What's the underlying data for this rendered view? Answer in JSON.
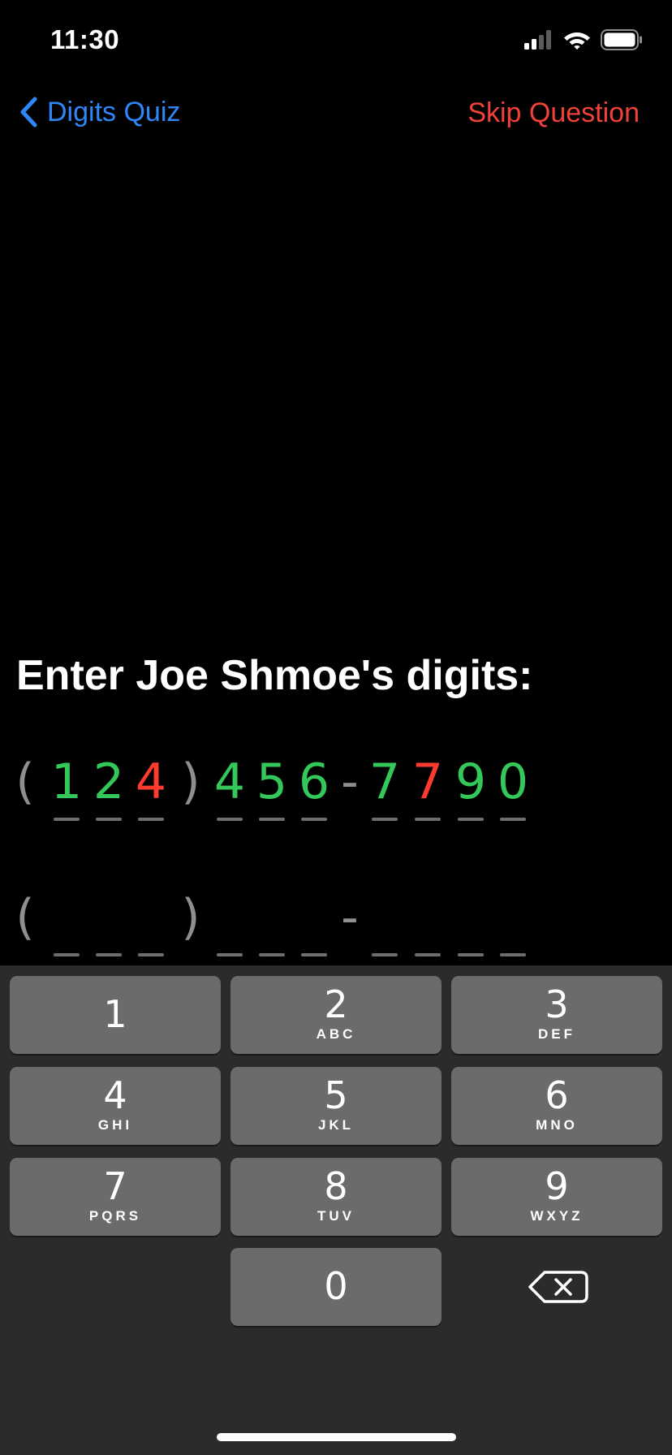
{
  "status_bar": {
    "time": "11:30",
    "icons": [
      "cellular-signal-icon",
      "wifi-icon",
      "battery-icon"
    ]
  },
  "nav": {
    "back_label": "Digits Quiz",
    "skip_label": "Skip Question",
    "back_color": "#2f86f6",
    "skip_color": "#f04238"
  },
  "prompt": "Enter Joe Shmoe's digits:",
  "answer": {
    "open_paren": "(",
    "close_paren": ")",
    "dash": "-",
    "digits": [
      {
        "value": "1",
        "correct": true
      },
      {
        "value": "2",
        "correct": true
      },
      {
        "value": "4",
        "correct": false
      },
      {
        "value": "4",
        "correct": true
      },
      {
        "value": "5",
        "correct": true
      },
      {
        "value": "6",
        "correct": true
      },
      {
        "value": "7",
        "correct": true
      },
      {
        "value": "7",
        "correct": false
      },
      {
        "value": "9",
        "correct": true
      },
      {
        "value": "0",
        "correct": true
      }
    ]
  },
  "entry": {
    "open_paren": "(",
    "close_paren": ")",
    "dash": "-"
  },
  "colors": {
    "correct": "#34c759",
    "incorrect": "#ff3b30",
    "punctuation": "#8e8e93"
  },
  "keypad": {
    "keys": [
      {
        "digit": "1",
        "letters": ""
      },
      {
        "digit": "2",
        "letters": "ABC"
      },
      {
        "digit": "3",
        "letters": "DEF"
      },
      {
        "digit": "4",
        "letters": "GHI"
      },
      {
        "digit": "5",
        "letters": "JKL"
      },
      {
        "digit": "6",
        "letters": "MNO"
      },
      {
        "digit": "7",
        "letters": "PQRS"
      },
      {
        "digit": "8",
        "letters": "TUV"
      },
      {
        "digit": "9",
        "letters": "WXYZ"
      },
      {
        "digit": "0",
        "letters": ""
      }
    ],
    "delete_icon": "backspace-icon"
  }
}
